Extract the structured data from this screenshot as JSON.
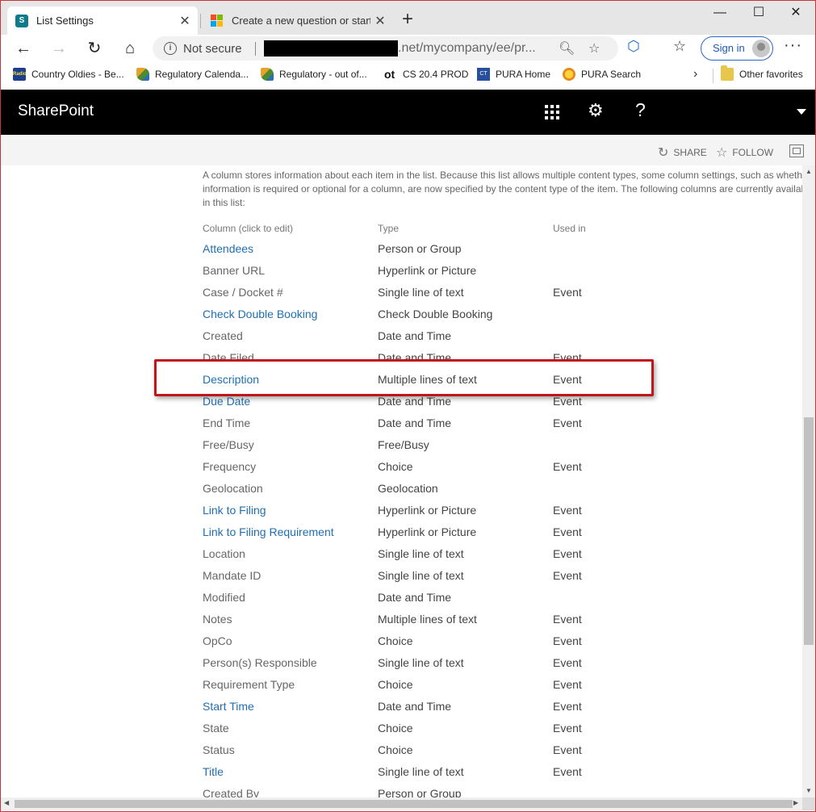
{
  "browser": {
    "tabs": [
      {
        "title": "List Settings",
        "close": "✕"
      },
      {
        "title": "Create a new question or start a",
        "close": "✕"
      }
    ],
    "newtab": "+",
    "window_controls": {
      "minimize": "—",
      "maximize": "☐",
      "close": "✕"
    },
    "address": {
      "security_label": "Not secure",
      "url_visible": ".net/mycompany/ee/pr..."
    },
    "signin_label": "Sign in",
    "more": "···",
    "favorites": [
      {
        "label": "Country Oldies - Be..."
      },
      {
        "label": "Regulatory Calenda..."
      },
      {
        "label": "Regulatory - out of..."
      },
      {
        "label": "CS 20.4 PROD"
      },
      {
        "label": "PURA Home"
      },
      {
        "label": "PURA Search"
      }
    ],
    "favorites_overflow": "›",
    "other_favorites": "Other favorites"
  },
  "sharepoint": {
    "title": "SharePoint",
    "actions": {
      "share": "SHARE",
      "follow": "FOLLOW"
    }
  },
  "content": {
    "intro": "A column stores information about each item in the list. Because this list allows multiple content types, some column settings, such as whether information is required or optional for a column, are now specified by the content type of the item. The following columns are currently available in this list:",
    "headers": {
      "column": "Column (click to edit)",
      "type": "Type",
      "used_in": "Used in"
    },
    "rows": [
      {
        "name": "Attendees",
        "type": "Person or Group",
        "used": "",
        "link": true
      },
      {
        "name": "Banner URL",
        "type": "Hyperlink or Picture",
        "used": "",
        "link": false
      },
      {
        "name": "Case / Docket #",
        "type": "Single line of text",
        "used": "Event",
        "link": false
      },
      {
        "name": "Check Double Booking",
        "type": "Check Double Booking",
        "used": "",
        "link": true
      },
      {
        "name": "Created",
        "type": "Date and Time",
        "used": "",
        "link": false
      },
      {
        "name": "Date Filed",
        "type": "Date and Time",
        "used": "Event",
        "link": false
      },
      {
        "name": "Description",
        "type": "Multiple lines of text",
        "used": "Event",
        "link": true
      },
      {
        "name": "Due Date",
        "type": "Date and Time",
        "used": "Event",
        "link": true
      },
      {
        "name": "End Time",
        "type": "Date and Time",
        "used": "Event",
        "link": false
      },
      {
        "name": "Free/Busy",
        "type": "Free/Busy",
        "used": "",
        "link": false
      },
      {
        "name": "Frequency",
        "type": "Choice",
        "used": "Event",
        "link": false
      },
      {
        "name": "Geolocation",
        "type": "Geolocation",
        "used": "",
        "link": false
      },
      {
        "name": "Link to Filing",
        "type": "Hyperlink or Picture",
        "used": "Event",
        "link": true
      },
      {
        "name": "Link to Filing Requirement",
        "type": "Hyperlink or Picture",
        "used": "Event",
        "link": true
      },
      {
        "name": "Location",
        "type": "Single line of text",
        "used": "Event",
        "link": false
      },
      {
        "name": "Mandate ID",
        "type": "Single line of text",
        "used": "Event",
        "link": false
      },
      {
        "name": "Modified",
        "type": "Date and Time",
        "used": "",
        "link": false
      },
      {
        "name": "Notes",
        "type": "Multiple lines of text",
        "used": "Event",
        "link": false
      },
      {
        "name": "OpCo",
        "type": "Choice",
        "used": "Event",
        "link": false
      },
      {
        "name": "Person(s) Responsible",
        "type": "Single line of text",
        "used": "Event",
        "link": false
      },
      {
        "name": "Requirement Type",
        "type": "Choice",
        "used": "Event",
        "link": false
      },
      {
        "name": "Start Time",
        "type": "Date and Time",
        "used": "Event",
        "link": true
      },
      {
        "name": "State",
        "type": "Choice",
        "used": "Event",
        "link": false
      },
      {
        "name": "Status",
        "type": "Choice",
        "used": "Event",
        "link": false
      },
      {
        "name": "Title",
        "type": "Single line of text",
        "used": "Event",
        "link": true
      },
      {
        "name": "Created By",
        "type": "Person or Group",
        "used": "",
        "link": false
      }
    ]
  },
  "colors": {
    "link": "#1f6fb2",
    "highlight_border": "#c1151a",
    "suitebar": "#000000"
  }
}
